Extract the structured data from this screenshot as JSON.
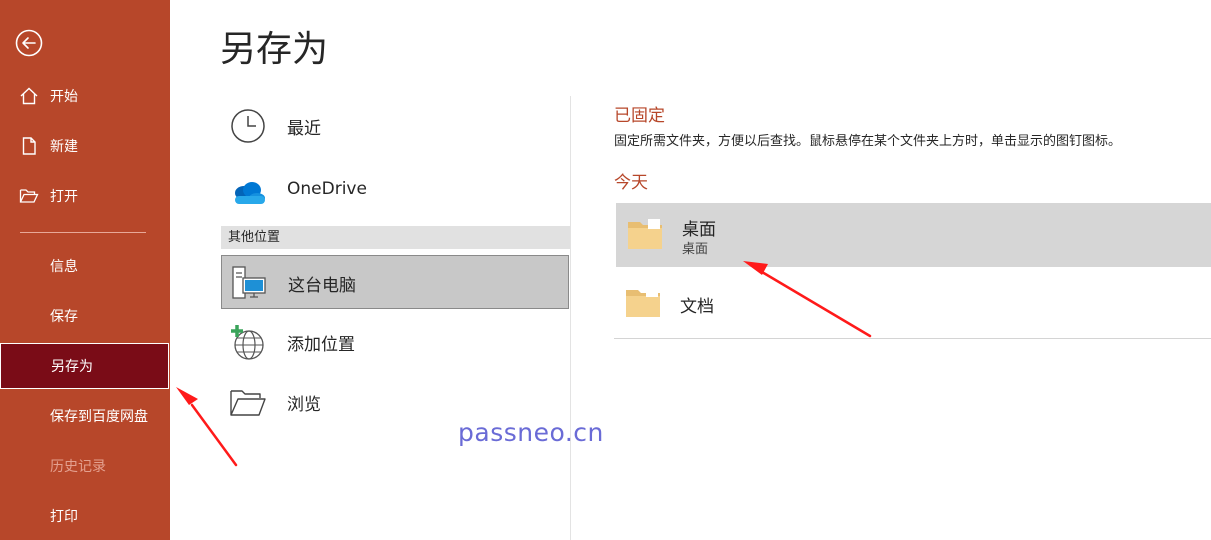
{
  "sidebar": {
    "items": [
      {
        "label": "开始",
        "icon": "home-icon"
      },
      {
        "label": "新建",
        "icon": "new-document-icon"
      },
      {
        "label": "打开",
        "icon": "open-folder-icon"
      },
      {
        "label": "信息"
      },
      {
        "label": "保存"
      },
      {
        "label": "另存为",
        "active": true
      },
      {
        "label": "保存到百度网盘"
      },
      {
        "label": "历史记录",
        "disabled": true
      },
      {
        "label": "打印"
      }
    ]
  },
  "page_title": "另存为",
  "locations": {
    "recent": "最近",
    "onedrive": "OneDrive",
    "other_header": "其他位置",
    "this_pc": "这台电脑",
    "add_place": "添加位置",
    "browse": "浏览"
  },
  "right_panel": {
    "pinned_header": "已固定",
    "pinned_desc": "固定所需文件夹，方便以后查找。鼠标悬停在某个文件夹上方时，单击显示的图钉图标。",
    "today_header": "今天",
    "folders": [
      {
        "name": "桌面",
        "path": "桌面"
      },
      {
        "name": "文档"
      }
    ]
  },
  "watermark": "passneo.cn",
  "colors": {
    "sidebar_bg": "#b7472a",
    "sidebar_active": "#7a0c17",
    "accent": "#b7472a",
    "annotation_arrow": "#ff1a1a"
  }
}
